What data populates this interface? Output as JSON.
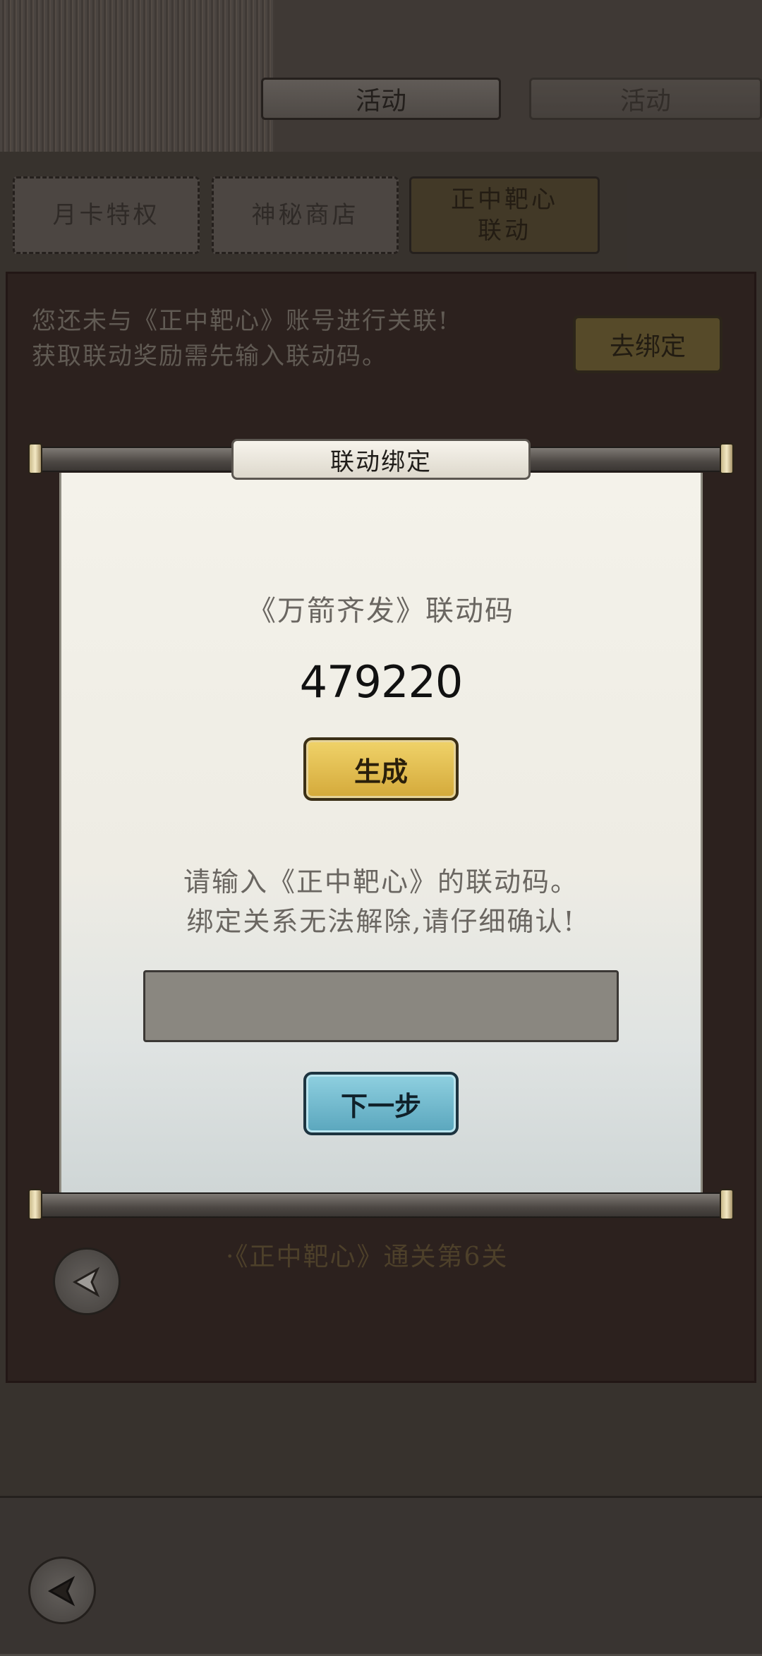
{
  "header": {
    "tab_active": "活动",
    "tab_ghost": "活动"
  },
  "subtabs": [
    {
      "label": "月卡特权"
    },
    {
      "label": "神秘商店"
    },
    {
      "label": "正中靶心\n联动"
    }
  ],
  "background": {
    "notice_line1": "您还未与《正中靶心》账号进行关联!",
    "notice_line2": "获取联动奖励需先输入联动码。",
    "bind_button": "去绑定",
    "requirement": "·《正中靶心》通关第6关"
  },
  "modal": {
    "title": "联动绑定",
    "code_label": "《万箭齐发》联动码",
    "code_value": "479220",
    "generate_button": "生成",
    "instruction_line1": "请输入《正中靶心》的联动码。",
    "instruction_line2": "绑定关系无法解除,请仔细确认!",
    "input_value": "",
    "input_placeholder": "",
    "next_button": "下一步"
  },
  "colors": {
    "gold_button": "#e3bf50",
    "blue_button": "#76bccf",
    "paper": "#f0eee6"
  },
  "icons": [
    "back-arrow-icon"
  ]
}
